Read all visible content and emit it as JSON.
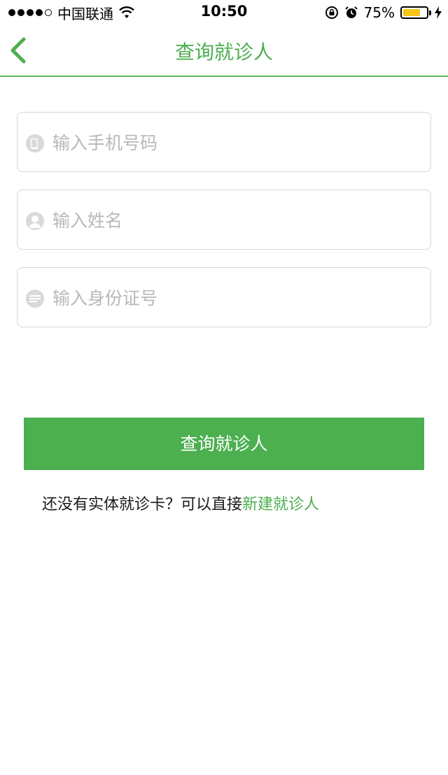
{
  "status_bar": {
    "carrier": "中国联通",
    "time": "10:50",
    "battery_percent": "75%",
    "battery_level": 0.75,
    "battery_color": "#f5c518"
  },
  "nav": {
    "title": "查询就诊人",
    "back_icon": "chevron-left-icon"
  },
  "form": {
    "phone": {
      "placeholder": "输入手机号码",
      "value": "",
      "icon": "phone-icon"
    },
    "name": {
      "placeholder": "输入姓名",
      "value": "",
      "icon": "person-icon"
    },
    "id_number": {
      "placeholder": "输入身份证号",
      "value": "",
      "icon": "id-card-icon"
    }
  },
  "actions": {
    "query_label": "查询就诊人"
  },
  "hint": {
    "text": "还没有实体就诊卡？可以直接",
    "link": "新建就诊人"
  },
  "colors": {
    "accent": "#4caf50",
    "divider": "#5cb85c",
    "placeholder": "#b8b8b8"
  }
}
